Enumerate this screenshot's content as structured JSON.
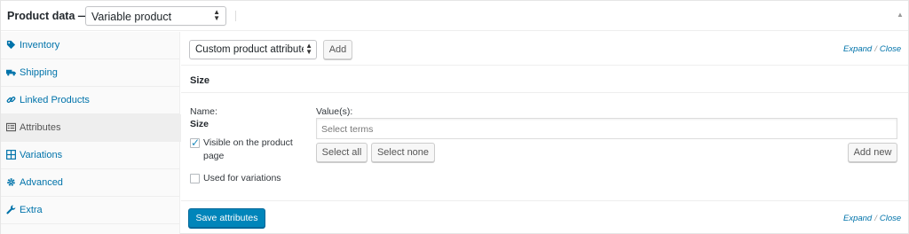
{
  "header": {
    "title": "Product data —",
    "product_type": "Variable product",
    "collapse_glyph": "▲"
  },
  "sidebar": {
    "items": [
      {
        "label": "Inventory",
        "icon": "tag-icon"
      },
      {
        "label": "Shipping",
        "icon": "truck-icon"
      },
      {
        "label": "Linked Products",
        "icon": "link-icon"
      },
      {
        "label": "Attributes",
        "icon": "list-icon",
        "active": true
      },
      {
        "label": "Variations",
        "icon": "grid-icon"
      },
      {
        "label": "Advanced",
        "icon": "gear-icon"
      },
      {
        "label": "Extra",
        "icon": "wrench-icon"
      }
    ]
  },
  "attributes": {
    "attribute_select": "Custom product attribute",
    "add_label": "Add",
    "expand_label": "Expand",
    "separator": "/",
    "close_label": "Close",
    "attribute": {
      "heading": "Size",
      "name_label": "Name:",
      "name_value": "Size",
      "visible_label": "Visible on the product page",
      "visible_checked": true,
      "variations_label": "Used for variations",
      "variations_checked": false,
      "values_label": "Value(s):",
      "values_placeholder": "Select terms",
      "select_all_label": "Select all",
      "select_none_label": "Select none",
      "add_new_label": "Add new"
    },
    "save_label": "Save attributes"
  },
  "colors": {
    "link": "#0073aa",
    "primary_button": "#0085ba",
    "checkbox_tick": "#1e8cbe"
  }
}
